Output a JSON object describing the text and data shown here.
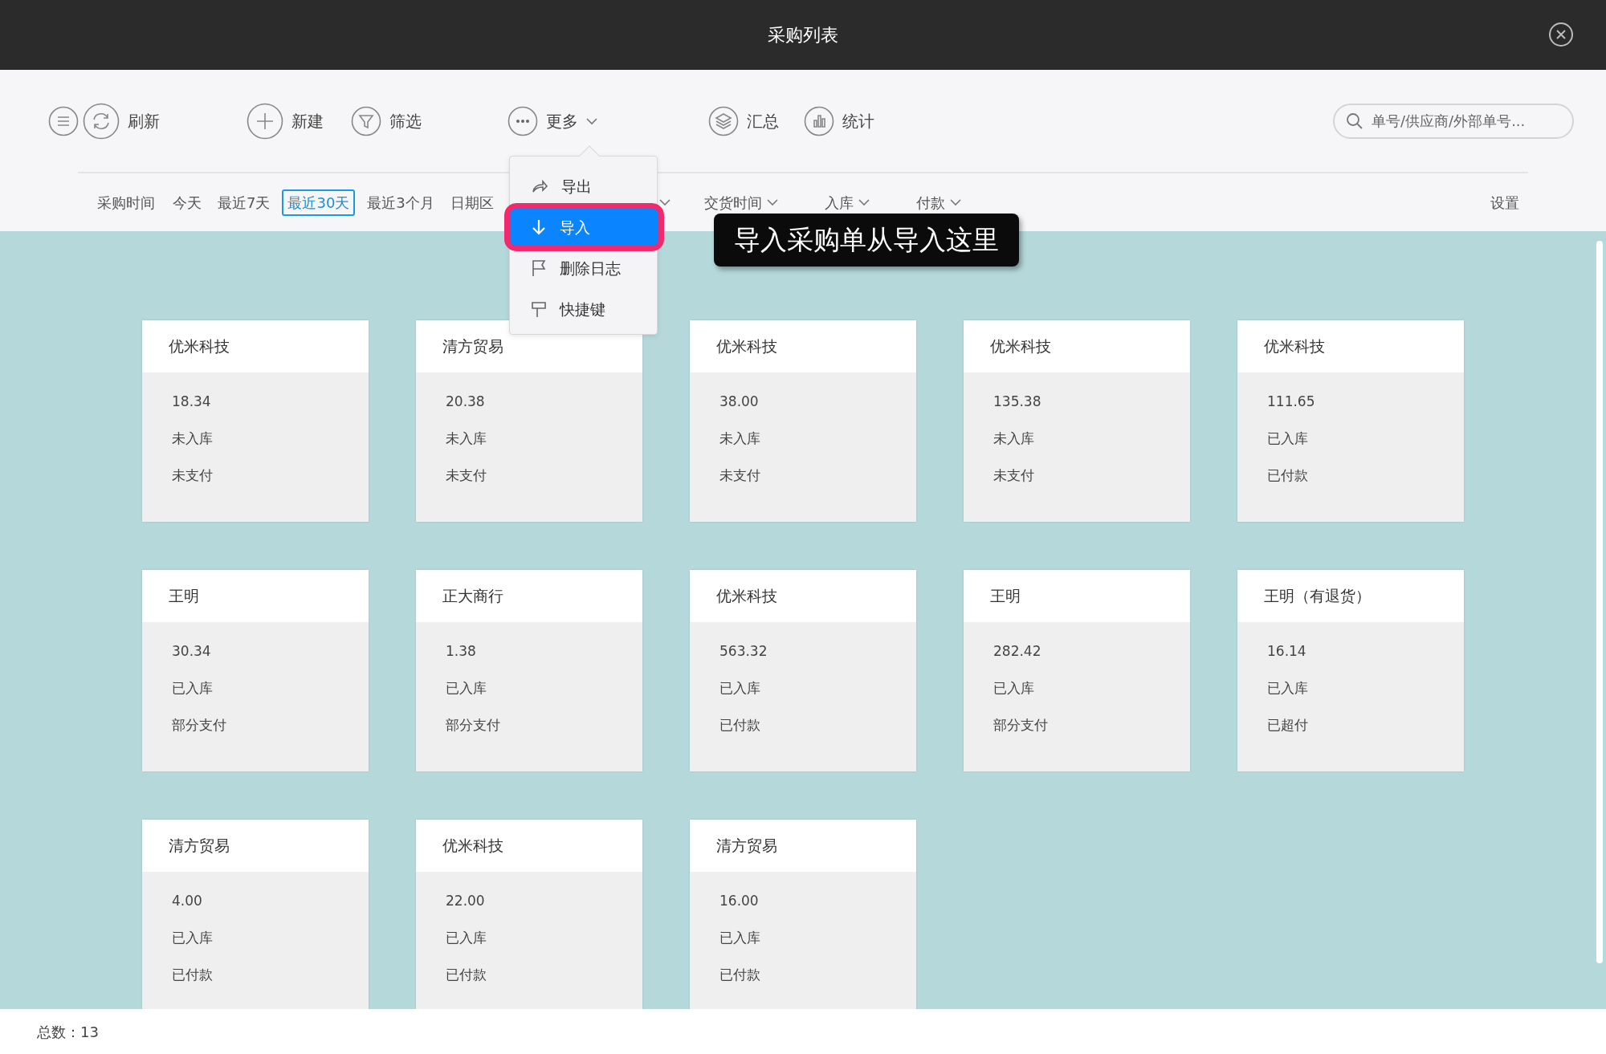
{
  "window": {
    "title": "采购列表"
  },
  "toolbar": [
    {
      "kind": "menu"
    },
    {
      "kind": "refresh",
      "label": "刷新"
    },
    {
      "kind": "new",
      "label": "新建"
    },
    {
      "kind": "filter",
      "label": "筛选"
    },
    {
      "kind": "more",
      "label": "更多"
    },
    {
      "kind": "summary",
      "label": "汇总"
    },
    {
      "kind": "stats",
      "label": "统计"
    }
  ],
  "search": {
    "placeholder": "单号/供应商/外部单号..."
  },
  "filters": {
    "label": "采购时间",
    "presets": [
      {
        "label": "今天",
        "selected": false
      },
      {
        "label": "最近7天",
        "selected": false
      },
      {
        "label": "最近30天",
        "selected": true
      },
      {
        "label": "最近3个月",
        "selected": false
      },
      {
        "label": "日期区",
        "selected": false
      }
    ],
    "dropdowns": [
      {
        "kind": "covered"
      },
      {
        "kind": "labeled",
        "label": "交货时间"
      },
      {
        "kind": "labeled",
        "label": "入库"
      },
      {
        "kind": "labeled",
        "label": "付款"
      }
    ],
    "settings": "设置"
  },
  "more_menu": [
    {
      "kind": "export",
      "label": "导出",
      "selected": false
    },
    {
      "kind": "import",
      "label": "导入",
      "selected": true
    },
    {
      "kind": "log",
      "label": "删除日志",
      "selected": false
    },
    {
      "kind": "shortcut",
      "label": "快捷键",
      "selected": false
    }
  ],
  "tooltip": "导入采购单从导入这里",
  "cards": [
    {
      "name": "优米科技",
      "amount": "18.34",
      "stock": "未入库",
      "payment": "未支付"
    },
    {
      "name": "清方贸易",
      "amount": "20.38",
      "stock": "未入库",
      "payment": "未支付"
    },
    {
      "name": "优米科技",
      "amount": "38.00",
      "stock": "未入库",
      "payment": "未支付"
    },
    {
      "name": "优米科技",
      "amount": "135.38",
      "stock": "未入库",
      "payment": "未支付"
    },
    {
      "name": "优米科技",
      "amount": "111.65",
      "stock": "已入库",
      "payment": "已付款"
    },
    {
      "name": "王明",
      "amount": "30.34",
      "stock": "已入库",
      "payment": "部分支付"
    },
    {
      "name": "正大商行",
      "amount": "1.38",
      "stock": "已入库",
      "payment": "部分支付"
    },
    {
      "name": "优米科技",
      "amount": "563.32",
      "stock": "已入库",
      "payment": "已付款"
    },
    {
      "name": "王明",
      "amount": "282.42",
      "stock": "已入库",
      "payment": "部分支付"
    },
    {
      "name": "王明（有退货）",
      "amount": "16.14",
      "stock": "已入库",
      "payment": "已超付"
    },
    {
      "name": "清方贸易",
      "amount": "4.00",
      "stock": "已入库",
      "payment": "已付款"
    },
    {
      "name": "优米科技",
      "amount": "22.00",
      "stock": "已入库",
      "payment": "已付款"
    },
    {
      "name": "清方贸易",
      "amount": "16.00",
      "stock": "已入库",
      "payment": "已付款"
    }
  ],
  "status_bar": {
    "total": "总数：13"
  }
}
